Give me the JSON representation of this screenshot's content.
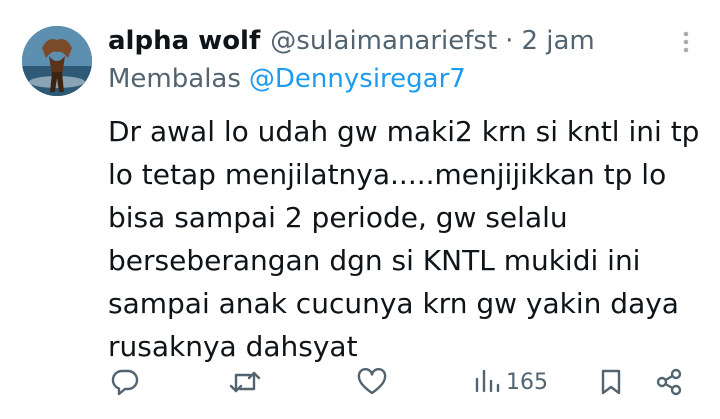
{
  "tweet": {
    "display_name": "alpha wolf",
    "handle": "@sulaimanariefst",
    "separator": "·",
    "time": "2 jam",
    "reply_prefix": "Membalas",
    "reply_to": "@Dennysiregar7",
    "body_lines": [
      "Dr awal lo udah gw maki2 krn si kntl ini tp",
      "lo tetap menjilatnya.....menjijikkan tp lo",
      "bisa sampai 2 periode, gw selalu",
      "berseberangan dgn si KNTL mukidi ini",
      "sampai anak cucunya krn gw yakin daya",
      "rusaknya dahsyat"
    ]
  },
  "actions": {
    "reply_icon": "reply-icon",
    "retweet_icon": "retweet-icon",
    "like_icon": "heart-icon",
    "views_icon": "views-icon",
    "views_count": "165",
    "bookmark_icon": "bookmark-icon",
    "share_icon": "share-icon"
  },
  "colors": {
    "text": "#0f1419",
    "muted": "#536471",
    "link": "#1d9bf0"
  }
}
